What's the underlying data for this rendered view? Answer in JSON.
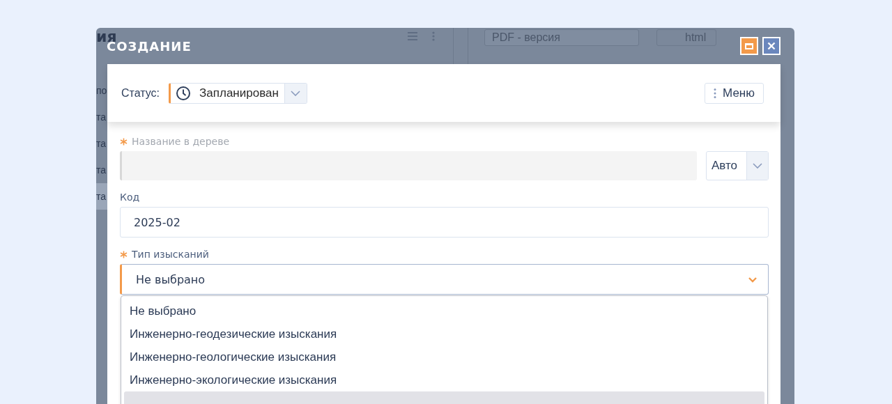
{
  "background_app": {
    "heading_fragment": "ия",
    "row_fragments": [
      {
        "text": "по",
        "selected": false
      },
      {
        "text": "та",
        "selected": false
      },
      {
        "text": "та",
        "selected": false
      },
      {
        "text": "та",
        "selected": false
      },
      {
        "text": "та",
        "selected": true
      }
    ],
    "format_select": "PDF - версия",
    "html_button": "html"
  },
  "dialog": {
    "title": "СОЗДАНИЕ",
    "status": {
      "label": "Статус:",
      "value": "Запланирован"
    },
    "menu_button": "Меню",
    "fields": [
      {
        "kind": "auto",
        "label": "Название в дереве",
        "required": true,
        "mode": "Авто"
      },
      {
        "kind": "text",
        "label": "Код",
        "required": false,
        "value": "2025-02"
      },
      {
        "kind": "select",
        "label": "Тип изысканий",
        "required": true,
        "value": "Не выбрано",
        "expanded": true,
        "options": [
          "Не выбрано",
          "Инженерно-геодезические изыскания",
          "Инженерно-геологические изыскания",
          "Инженерно-экологические изыскания"
        ]
      }
    ]
  }
}
